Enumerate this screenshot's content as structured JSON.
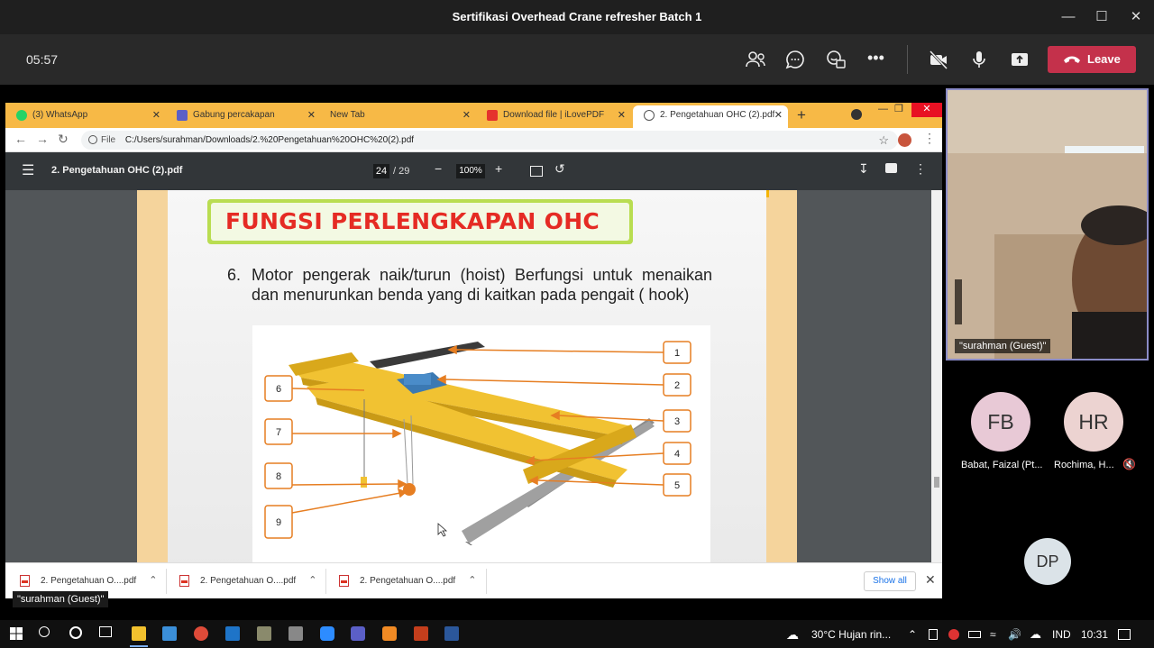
{
  "window": {
    "title": "Sertifikasi Overhead Crane refresher Batch 1"
  },
  "meeting": {
    "timer": "05:57",
    "leave_label": "Leave"
  },
  "browser": {
    "tabs": [
      {
        "label": "(3) WhatsApp"
      },
      {
        "label": "Gabung percakapan"
      },
      {
        "label": "New Tab"
      },
      {
        "label": "Download file | iLovePDF"
      },
      {
        "label": "2. Pengetahuan OHC (2).pdf"
      }
    ],
    "address": {
      "scheme": "File",
      "url": "C:/Users/surahman/Downloads/2.%20Pengetahuan%20OHC%20(2).pdf"
    }
  },
  "pdf": {
    "file_name": "2. Pengetahuan OHC (2).pdf",
    "page_current": "24",
    "page_total": "/ 29",
    "zoom": "100%",
    "slide": {
      "title": "FUNGSI PERLENGKAPAN OHC",
      "item_number": "6.",
      "item_text": "Motor pengerak naik/turun (hoist) Berfungsi untuk menaikan dan menurunkan benda yang di kaitkan pada pengait ( hook)",
      "callouts": [
        "1",
        "2",
        "3",
        "4",
        "5",
        "6",
        "7",
        "8",
        "9"
      ]
    }
  },
  "downloads": {
    "items": [
      {
        "label": "2. Pengetahuan O....pdf"
      },
      {
        "label": "2. Pengetahuan O....pdf"
      },
      {
        "label": "2. Pengetahuan O....pdf"
      }
    ],
    "show_all": "Show all"
  },
  "presenter_label": "\"surahman (Guest)\"",
  "participants": {
    "video_label": "\"surahman (Guest)\"",
    "list": [
      {
        "initials": "FB",
        "name": "Babat, Faizal (Pt..."
      },
      {
        "initials": "HR",
        "name": "Rochima, H..."
      },
      {
        "initials": "DP",
        "name": ""
      }
    ]
  },
  "taskbar": {
    "weather": "30°C  Hujan rin...",
    "language": "IND",
    "time": "10:31"
  }
}
